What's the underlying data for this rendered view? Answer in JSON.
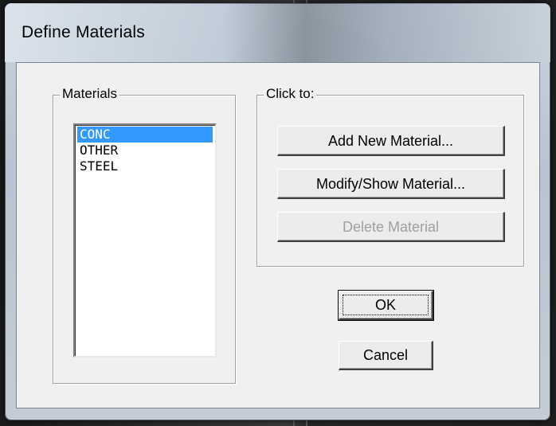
{
  "window": {
    "title": "Define Materials"
  },
  "materials_group": {
    "legend": "Materials",
    "items": [
      {
        "label": "CONC",
        "selected": true
      },
      {
        "label": "OTHER",
        "selected": false
      },
      {
        "label": "STEEL",
        "selected": false
      }
    ]
  },
  "clickto_group": {
    "legend": "Click to:",
    "add_label": "Add New Material...",
    "modify_label": "Modify/Show Material...",
    "delete_label": "Delete Material"
  },
  "buttons": {
    "ok_label": "OK",
    "cancel_label": "Cancel"
  },
  "colors": {
    "selection": "#3399ff",
    "dialog_bg": "#f0f0f0",
    "disabled_text": "#a0a0a0"
  }
}
